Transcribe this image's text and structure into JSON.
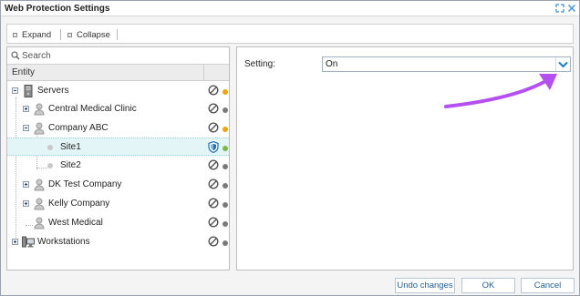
{
  "window": {
    "title": "Web Protection Settings",
    "icons": {
      "maximize": "expand-arrows-icon",
      "close": "close-x-icon"
    }
  },
  "toolbar": {
    "expand_label": "Expand",
    "collapse_label": "Collapse"
  },
  "tree": {
    "search_placeholder": "Search",
    "column_entity": "Entity",
    "rows": [
      {
        "label": "Servers",
        "icon": "server-icon",
        "expander": "minus",
        "status_color": "#f0a30a"
      },
      {
        "label": "Central Medical Clinic",
        "icon": "user-icon",
        "expander": "plus",
        "status_color": "#7a7a7a"
      },
      {
        "label": "Company ABC",
        "icon": "user-icon",
        "expander": "minus",
        "status_color": "#f0a30a"
      },
      {
        "label": "Site1",
        "icon": "site-dot-icon",
        "expander": "none",
        "status_icon": "shield-icon",
        "status_color": "#7ab648",
        "selected": true
      },
      {
        "label": "Site2",
        "icon": "site-dot-icon",
        "expander": "none",
        "status_color": "#7a7a7a"
      },
      {
        "label": "DK Test Company",
        "icon": "user-icon",
        "expander": "plus",
        "status_color": "#7a7a7a"
      },
      {
        "label": "Kelly Company",
        "icon": "user-icon",
        "expander": "plus",
        "status_color": "#7a7a7a"
      },
      {
        "label": "West Medical",
        "icon": "user-icon",
        "expander": "none",
        "status_color": "#7a7a7a"
      },
      {
        "label": "Workstations",
        "icon": "workstation-icon",
        "expander": "plus",
        "status_color": "#7a7a7a"
      }
    ]
  },
  "settings": {
    "setting_label": "Setting:",
    "setting_value": "On",
    "accent_color": "#1a7fc1",
    "annotation_arrow_color": "#b44ff0"
  },
  "footer": {
    "undo_label": "Undo changes",
    "ok_label": "OK",
    "cancel_label": "Cancel"
  }
}
